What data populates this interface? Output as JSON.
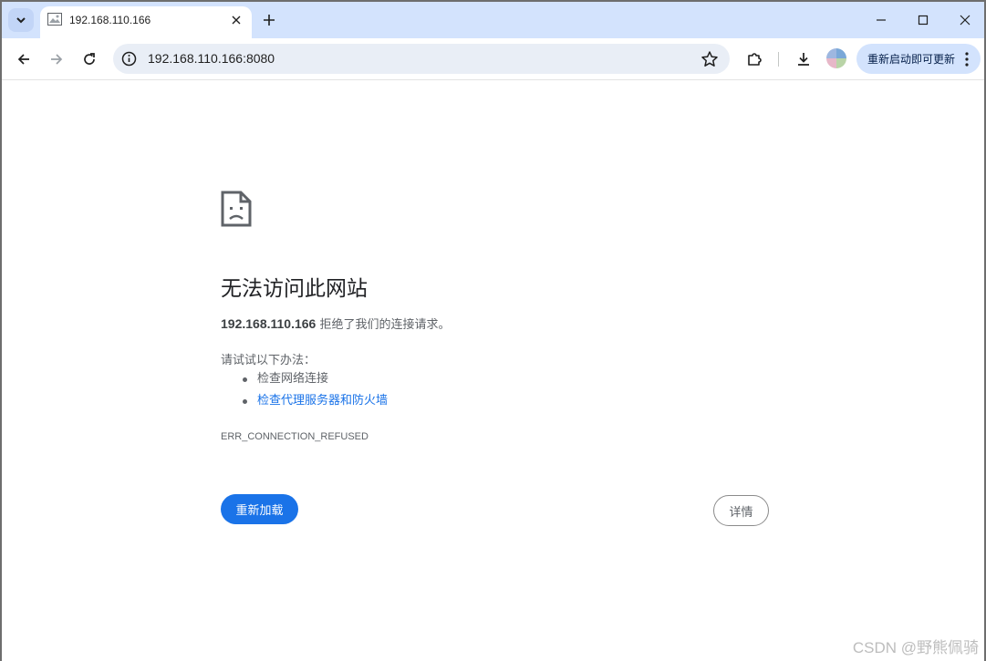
{
  "tab": {
    "title": "192.168.110.166"
  },
  "window_controls": {
    "minimize": "minimize",
    "maximize": "maximize",
    "close": "close"
  },
  "omnibox": {
    "url": "192.168.110.166:8080"
  },
  "toolbar": {
    "update_label": "重新启动即可更新"
  },
  "error_page": {
    "heading": "无法访问此网站",
    "host": "192.168.110.166",
    "message": "拒绝了我们的连接请求。",
    "try_label": "请试试以下办法：",
    "suggestions": [
      "检查网络连接",
      "检查代理服务器和防火墙"
    ],
    "error_code": "ERR_CONNECTION_REFUSED",
    "reload_label": "重新加载",
    "details_label": "详情"
  },
  "watermark": "CSDN @野熊佩骑",
  "colors": {
    "tab_strip": "#d3e3fd",
    "primary_button": "#1a73e8",
    "link": "#1a73e8"
  }
}
